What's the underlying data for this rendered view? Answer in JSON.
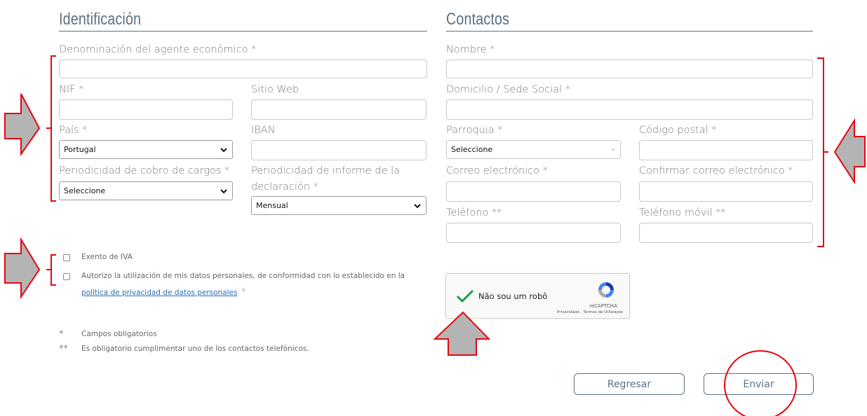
{
  "identificacion": {
    "title": "Identificación",
    "denominacion_label": "Denominación del agente económico",
    "nif_label": "NIF",
    "sitio_web_label": "Sitio Web",
    "pais_label": "País",
    "pais_value": "Portugal",
    "iban_label": "IBAN",
    "periodicidad_cobro_label": "Periodicidad de cobro de cargos",
    "periodicidad_cobro_value": "Seleccione",
    "periodicidad_informe_label_1": "Periodicidad de informe de la",
    "periodicidad_informe_label_2": "declaración",
    "periodicidad_informe_value": "Mensual",
    "required_mark": "*"
  },
  "contactos": {
    "title": "Contactos",
    "nombre_label": "Nombre",
    "domicilio_label": "Domicilio / Sede Social",
    "parroquia_label": "Parroquia",
    "parroquia_value": "Seleccione",
    "codigo_postal_label": "Código postal",
    "correo_label": "Correo electrónico",
    "confirmar_correo_label": "Confirmar correo electrónico",
    "telefono_label": "Teléfono",
    "telefono_movil_label": "Teléfono móvil",
    "required_mark": "*",
    "phone_mark": "**"
  },
  "checkboxes": {
    "exento_iva": "Exento de IVA",
    "autorizo_text": "Autorizo la utilización de mis datos personales, de conformidad con lo establecido en la",
    "politica_link": "política de privacidad de datos personales",
    "required_mark": "*"
  },
  "captcha": {
    "label": "Não sou um robô",
    "brand": "reCAPTCHA",
    "privacy": "Privacidade",
    "separator": " - ",
    "terms": "Termos de Utilização"
  },
  "notes": {
    "single_mark": "*",
    "single_text": "Campos obligatorios",
    "double_mark": "**",
    "double_text": "Es obligatorio cumplimentar uno de los contactos telefónicos."
  },
  "buttons": {
    "regresar": "Regresar",
    "enviar": "Enviar"
  },
  "annotation_color": "#e3070f",
  "arrow_fill": "#b4b4b4"
}
